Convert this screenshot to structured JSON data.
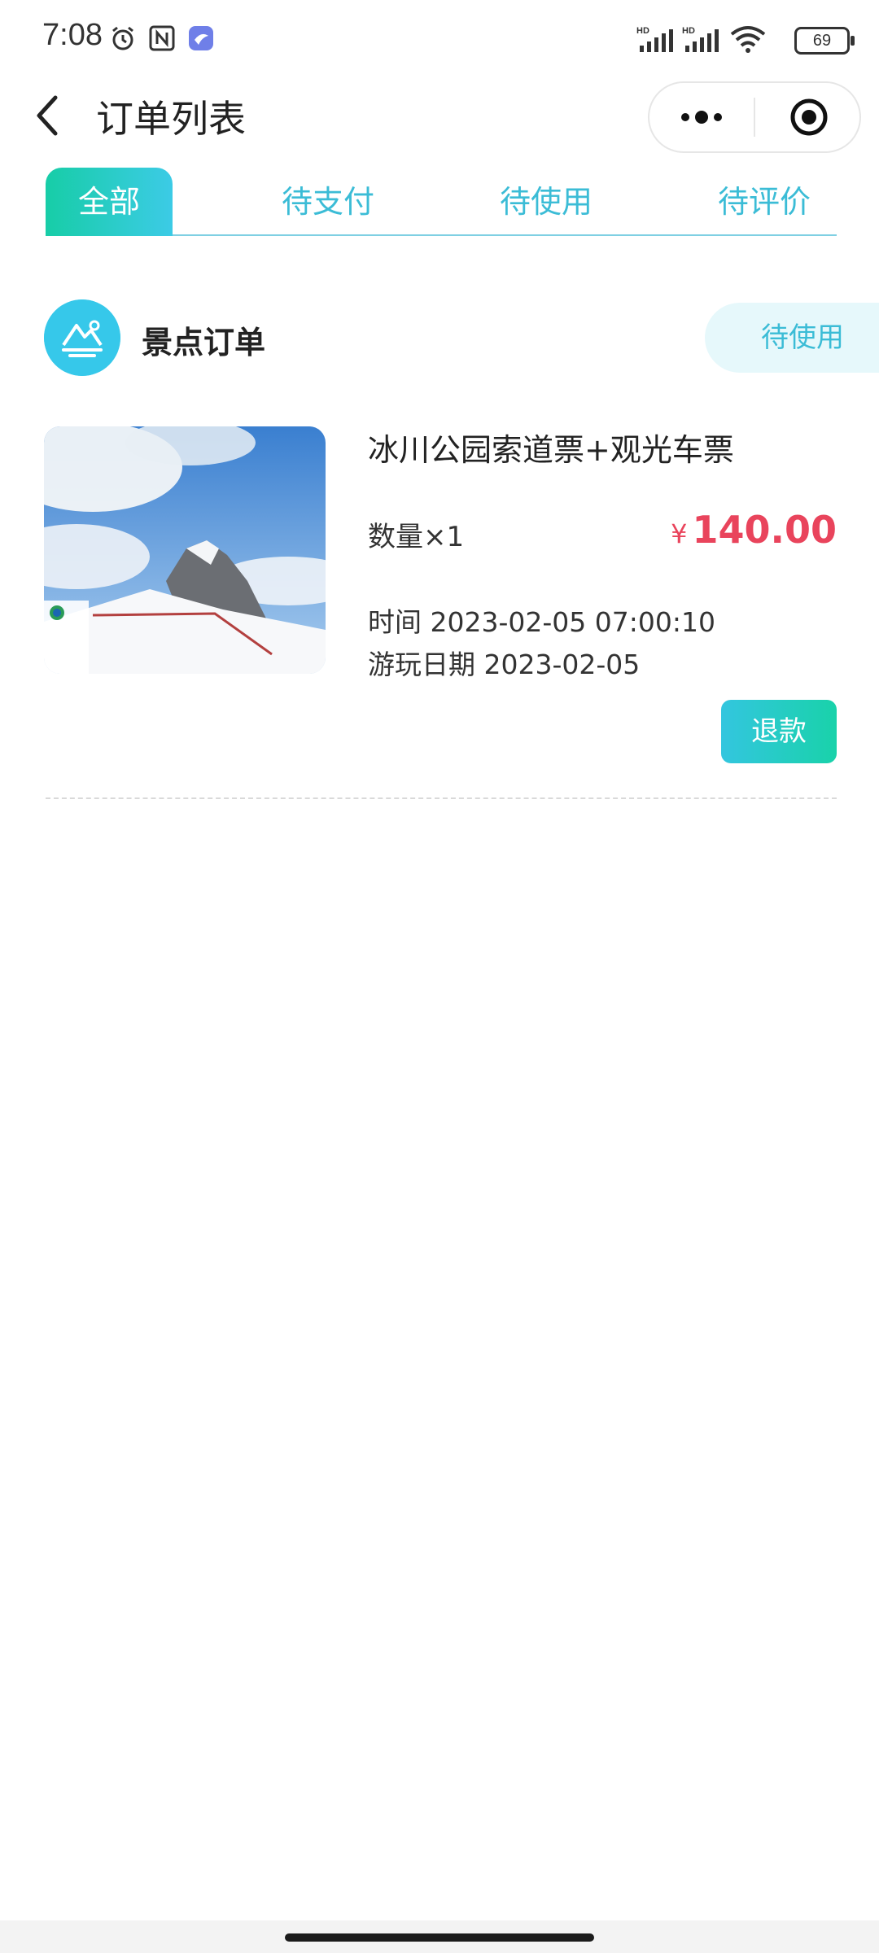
{
  "status_bar": {
    "time": "7:08",
    "battery": "69",
    "icons": [
      "alarm-icon",
      "nfc-icon",
      "app-notify-icon",
      "hd-signal-icon",
      "hd-signal-icon",
      "wifi-icon",
      "battery-icon"
    ]
  },
  "header": {
    "title": "订单列表"
  },
  "tabs": [
    {
      "label": "全部",
      "active": true
    },
    {
      "label": "待支付",
      "active": false
    },
    {
      "label": "待使用",
      "active": false
    },
    {
      "label": "待评价",
      "active": false
    }
  ],
  "order": {
    "shop_name": "景点订单",
    "status": "待使用",
    "product_name": "冰川公园索道票+观光车票",
    "quantity": "数量×1",
    "currency": "¥",
    "price": "140.00",
    "time": "时间 2023-02-05 07:00:10",
    "play_date": "游玩日期 2023-02-05",
    "refund_label": "退款"
  },
  "colors": {
    "accent": "#3bbcd6",
    "accent_green": "#17cda7",
    "price_red": "#e9445c",
    "pill_bg": "#e6f8fb"
  }
}
